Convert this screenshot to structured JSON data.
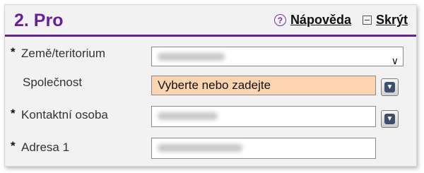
{
  "section": {
    "title": "2. Pro",
    "help_label": "Nápověda",
    "hide_label": "Skrýt"
  },
  "form": {
    "required_marker": "*",
    "country": {
      "label": "Země/teritorium",
      "value_obscured": true
    },
    "company": {
      "label": "Společnost",
      "placeholder": "Vyberte nebo zadejte"
    },
    "contact": {
      "label": "Kontaktní osoba",
      "value_obscured": true
    },
    "address1": {
      "label": "Adresa 1",
      "value_obscured": true
    }
  },
  "colors": {
    "accent": "#6a1f9a",
    "highlight_field": "#fdd4b0"
  }
}
